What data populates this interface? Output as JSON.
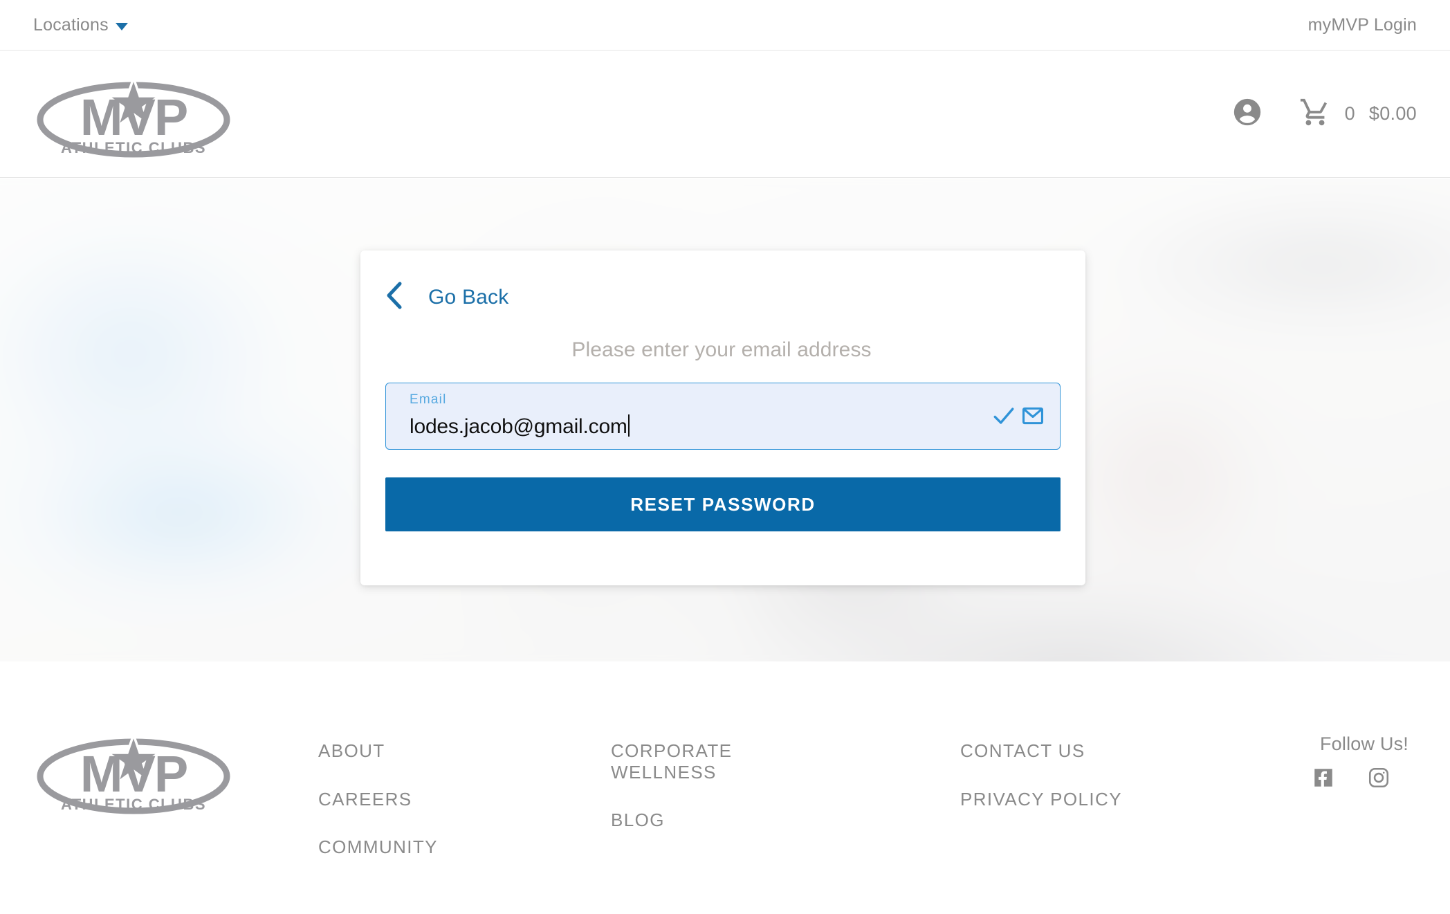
{
  "topbar": {
    "locations_label": "Locations",
    "login_label": "myMVP Login"
  },
  "header": {
    "logo_alt": "MVP ATHLETIC CLUBS",
    "logo_word": "MVP",
    "logo_tagline": "ATHLETIC CLUBS",
    "cart_count": "0",
    "cart_total": "$0.00"
  },
  "card": {
    "go_back_label": "Go Back",
    "prompt": "Please enter your email address",
    "email_label": "Email",
    "email_value": "lodes.jacob@gmail.com",
    "email_placeholder": "Email",
    "submit_label": "RESET PASSWORD"
  },
  "footer": {
    "logo_word": "MVP",
    "logo_tagline": "ATHLETIC CLUBS",
    "col1": [
      {
        "label": "ABOUT"
      },
      {
        "label": "CAREERS"
      },
      {
        "label": "COMMUNITY"
      }
    ],
    "col2": [
      {
        "label": "CORPORATE WELLNESS"
      },
      {
        "label": "BLOG"
      }
    ],
    "col3": [
      {
        "label": "CONTACT US"
      },
      {
        "label": "PRIVACY POLICY"
      }
    ],
    "follow_label": "Follow Us!",
    "social": [
      {
        "name": "facebook-icon"
      },
      {
        "name": "instagram-icon"
      }
    ]
  },
  "colors": {
    "accent_blue": "#0969a8",
    "link_blue": "#1b6fa8",
    "field_blue": "#2f93d8",
    "gray_text": "#8a8a8a",
    "logo_gray": "#9a9a9e"
  }
}
